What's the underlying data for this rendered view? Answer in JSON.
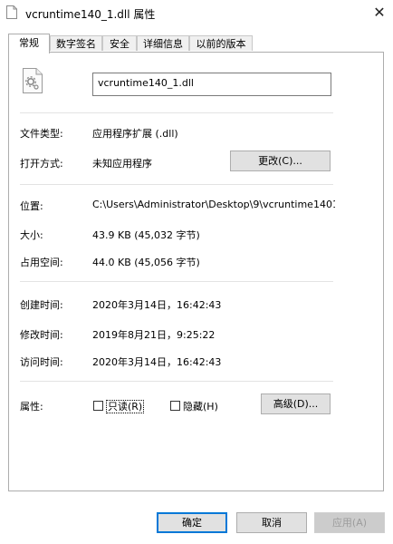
{
  "window": {
    "title": "vcruntime140_1.dll 属性",
    "close_glyph": "✕"
  },
  "tabs": [
    {
      "label": "常规",
      "active": true
    },
    {
      "label": "数字签名",
      "active": false
    },
    {
      "label": "安全",
      "active": false
    },
    {
      "label": "详细信息",
      "active": false
    },
    {
      "label": "以前的版本",
      "active": false
    }
  ],
  "general": {
    "file_icon": "dll-file-gear-icon",
    "filename": "vcruntime140_1.dll",
    "file_type_label": "文件类型:",
    "file_type_value": "应用程序扩展 (.dll)",
    "opens_with_label": "打开方式:",
    "opens_with_value": "未知应用程序",
    "change_button": "更改(C)...",
    "location_label": "位置:",
    "location_value": "C:\\Users\\Administrator\\Desktop\\9\\vcruntime1401",
    "size_label": "大小:",
    "size_value": "43.9 KB (45,032 字节)",
    "size_on_disk_label": "占用空间:",
    "size_on_disk_value": "44.0 KB (45,056 字节)",
    "created_label": "创建时间:",
    "created_value": "2020年3月14日，16:42:43",
    "modified_label": "修改时间:",
    "modified_value": "2019年8月21日，9:25:22",
    "accessed_label": "访问时间:",
    "accessed_value": "2020年3月14日，16:42:43",
    "attributes_label": "属性:",
    "readonly_label": "只读(R)",
    "readonly_checked": false,
    "hidden_label": "隐藏(H)",
    "hidden_checked": false,
    "advanced_button": "高级(D)..."
  },
  "footer": {
    "ok": "确定",
    "cancel": "取消",
    "apply": "应用(A)"
  },
  "colors": {
    "focus_border": "#0078d7",
    "button_bg": "#e1e1e1",
    "disabled_text": "#9c9c9c"
  }
}
